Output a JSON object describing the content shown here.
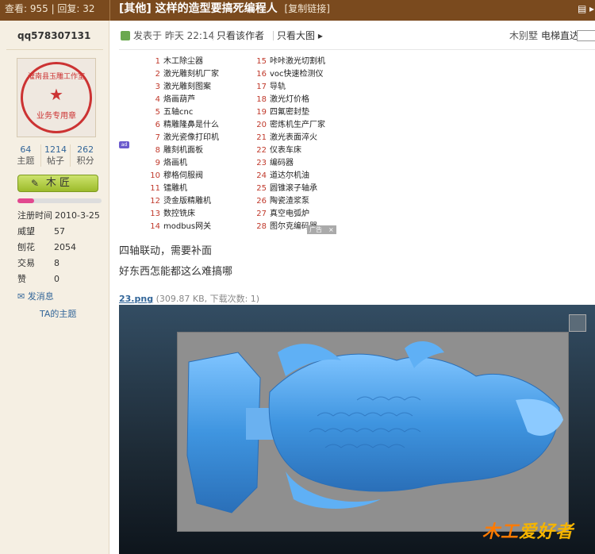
{
  "header": {
    "stats": "查看: 955 | 回复: 32",
    "title": "[其他] 这样的造型要搞死编程人",
    "copy_link": "[复制链接]"
  },
  "user": {
    "name": "qq578307131",
    "avatar_text": {
      "ring": "灌南县玉雕工作室",
      "bottom": "业务专用章"
    },
    "counts": [
      {
        "value": "64",
        "label": "主题"
      },
      {
        "value": "1214",
        "label": "帖子"
      },
      {
        "value": "262",
        "label": "积分"
      }
    ],
    "rank": "木 匠",
    "rank_progress": 0.2,
    "info": [
      {
        "key": "注册时间",
        "value": "2010-3-25"
      },
      {
        "key": "威望",
        "value": "57"
      },
      {
        "key": "刨花",
        "value": "2054"
      },
      {
        "key": "交易",
        "value": "8"
      },
      {
        "key": "赞",
        "value": "0"
      }
    ],
    "send_msg": "发消息",
    "ta_topics": "TA的主题"
  },
  "post": {
    "posted_at": "发表于 昨天 22:14",
    "view_author": "只看该作者",
    "view_large": "只看大图",
    "floor_label": "木别墅",
    "elevator": "电梯直达",
    "paragraph1": "四轴联动，需要补面",
    "paragraph2": "好东西怎能都这么难搞哪",
    "attachment_name": "23.png",
    "attachment_meta": "(309.87 KB, 下载次数: 1)"
  },
  "ads": {
    "tag": "广告",
    "close": "×",
    "left": [
      {
        "num": "1",
        "text": "木工除尘器"
      },
      {
        "num": "2",
        "text": "激光雕刻机厂家"
      },
      {
        "num": "3",
        "text": "激光雕刻图案"
      },
      {
        "num": "4",
        "text": "烙画葫芦"
      },
      {
        "num": "5",
        "text": "五轴cnc"
      },
      {
        "num": "6",
        "text": "精雕隆鼻是什么"
      },
      {
        "num": "7",
        "text": "激光瓷像打印机"
      },
      {
        "num": "8",
        "text": "雕刻机面板"
      },
      {
        "num": "9",
        "text": "烙画机"
      },
      {
        "num": "10",
        "text": "穆格伺服阀"
      },
      {
        "num": "11",
        "text": "镭雕机"
      },
      {
        "num": "12",
        "text": "烫金版精雕机"
      },
      {
        "num": "13",
        "text": "数控铣床"
      },
      {
        "num": "14",
        "text": "modbus网关"
      }
    ],
    "right": [
      {
        "num": "15",
        "text": "咔咔激光切割机"
      },
      {
        "num": "16",
        "text": "voc快速检测仪"
      },
      {
        "num": "17",
        "text": "导轨"
      },
      {
        "num": "18",
        "text": "激光灯价格"
      },
      {
        "num": "19",
        "text": "四氟密封垫"
      },
      {
        "num": "20",
        "text": "密炼机生产厂家"
      },
      {
        "num": "21",
        "text": "激光表面淬火"
      },
      {
        "num": "22",
        "text": "仪表车床"
      },
      {
        "num": "23",
        "text": "编码器"
      },
      {
        "num": "24",
        "text": "道达尔机油"
      },
      {
        "num": "25",
        "text": "圆锥滚子轴承"
      },
      {
        "num": "26",
        "text": "陶瓷渣浆泵"
      },
      {
        "num": "27",
        "text": "真空电弧炉"
      },
      {
        "num": "28",
        "text": "图尔克编码器"
      }
    ]
  },
  "image": {
    "watermark": "爱好者"
  },
  "colors": {
    "header_bg": "#7a4a1e",
    "sidebar_bg": "#f5efe3",
    "link": "#336699",
    "model_blue": "#4aa3e8"
  }
}
